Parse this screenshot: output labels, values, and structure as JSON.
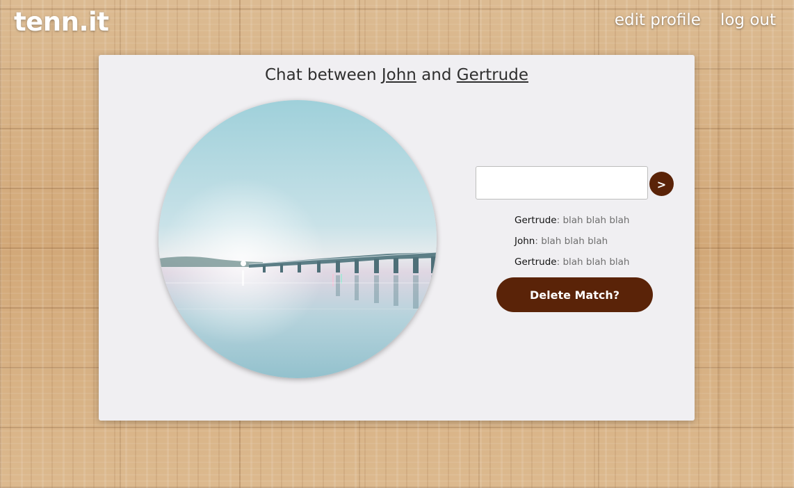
{
  "header": {
    "logo": "tenn.it",
    "nav": {
      "edit_profile": "edit profile",
      "log_out": "log out"
    }
  },
  "chat": {
    "title_prefix": "Chat between",
    "user_a": "John",
    "title_and": "and",
    "user_b": "Gertrude",
    "input_value": "",
    "send_label": ">",
    "messages": [
      {
        "sender": "Gertrude",
        "separator": ":",
        "text": " blah blah blah"
      },
      {
        "sender": "John",
        "separator": ":",
        "text": " blah blah blah"
      },
      {
        "sender": "Gertrude",
        "separator": ":",
        "text": " blah blah blah"
      }
    ],
    "delete_label": "Delete Match?"
  },
  "colors": {
    "accent": "#5a2308",
    "card_bg": "#f0eff2",
    "text_dark": "#2f2f2f",
    "text_muted": "#6f6f6f"
  },
  "icons": {
    "photo": "bridge-lake-photo"
  }
}
